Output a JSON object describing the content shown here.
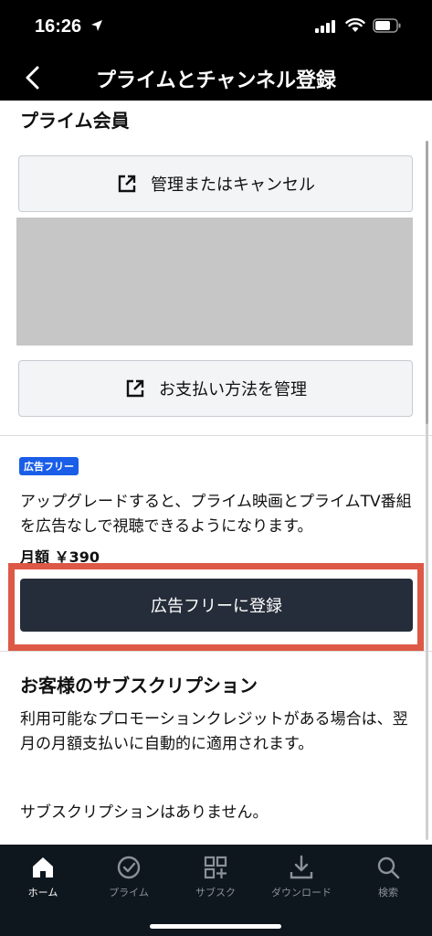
{
  "status_bar": {
    "time": "16:26"
  },
  "header": {
    "title": "プライムとチャンネル登録"
  },
  "prime": {
    "section_title": "プライム会員",
    "manage_cancel_label": "管理またはキャンセル",
    "payment_label": "お支払い方法を管理"
  },
  "ad_free": {
    "badge": "広告フリー",
    "description": "アップグレードすると、プライム映画とプライムTV番組を広告なしで視聴できるようになります。",
    "price": "月額 ￥390",
    "subscribe_label": "広告フリーに登録"
  },
  "subscriptions": {
    "title": "お客様のサブスクリプション",
    "description": "利用可能なプロモーションクレジットがある場合は、翌月の月額支払いに自動的に適用されます。",
    "empty_text": "サブスクリプションはありません。"
  },
  "bottom_nav": [
    {
      "label": "ホーム",
      "icon": "home-icon",
      "active": true
    },
    {
      "label": "プライム",
      "icon": "check-circle-icon",
      "active": false
    },
    {
      "label": "サブスク",
      "icon": "grid-plus-icon",
      "active": false
    },
    {
      "label": "ダウンロード",
      "icon": "download-icon",
      "active": false
    },
    {
      "label": "検索",
      "icon": "search-icon",
      "active": false
    }
  ],
  "colors": {
    "accent_blue": "#1a5ee8",
    "dark_button": "#262d3a",
    "highlight_red": "#dd5846",
    "nav_background": "#0f171e"
  }
}
